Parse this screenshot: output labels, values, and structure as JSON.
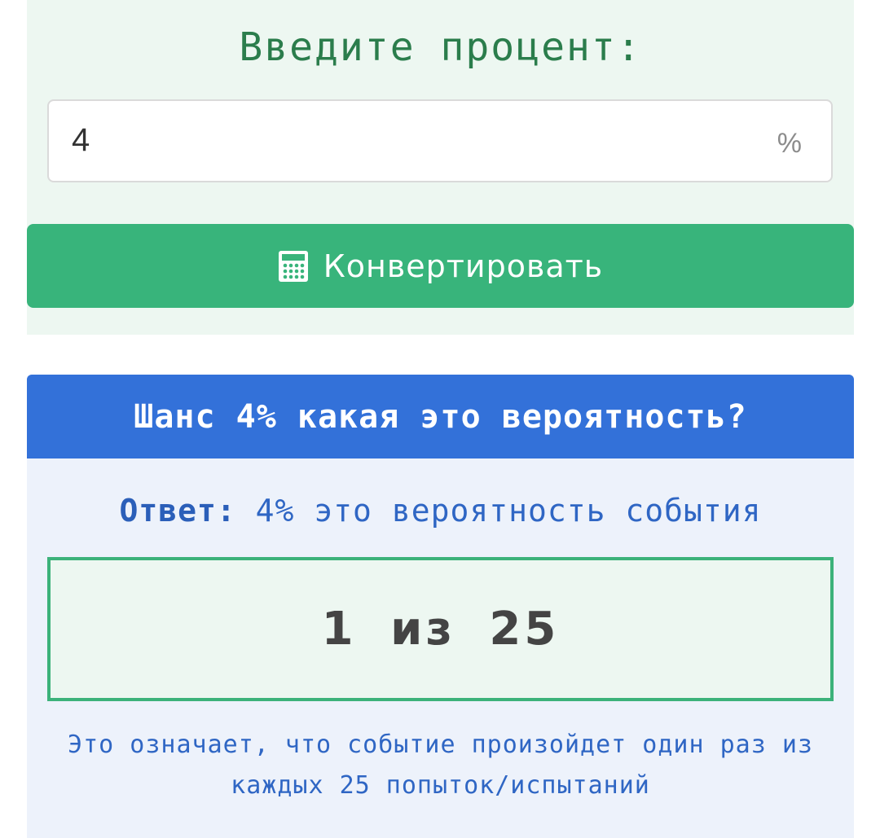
{
  "converter": {
    "label": "Введите процент:",
    "input_value": "4",
    "input_suffix": "%",
    "button_label": "Конвертировать",
    "button_icon": "calculator-icon"
  },
  "result": {
    "heading": "Шанс 4% какая это вероятность?",
    "answer_prefix": "Ответ:",
    "answer_text": "4% это вероятность события",
    "ratio": "1 из 25",
    "explanation": "Это означает, что событие произойдет один раз из каждых 25 попыток/испытаний"
  },
  "colors": {
    "accent_green": "#38b47b",
    "header_blue": "#3371d9",
    "label_green": "#2b7d4c",
    "text_blue": "#2f66c4"
  }
}
